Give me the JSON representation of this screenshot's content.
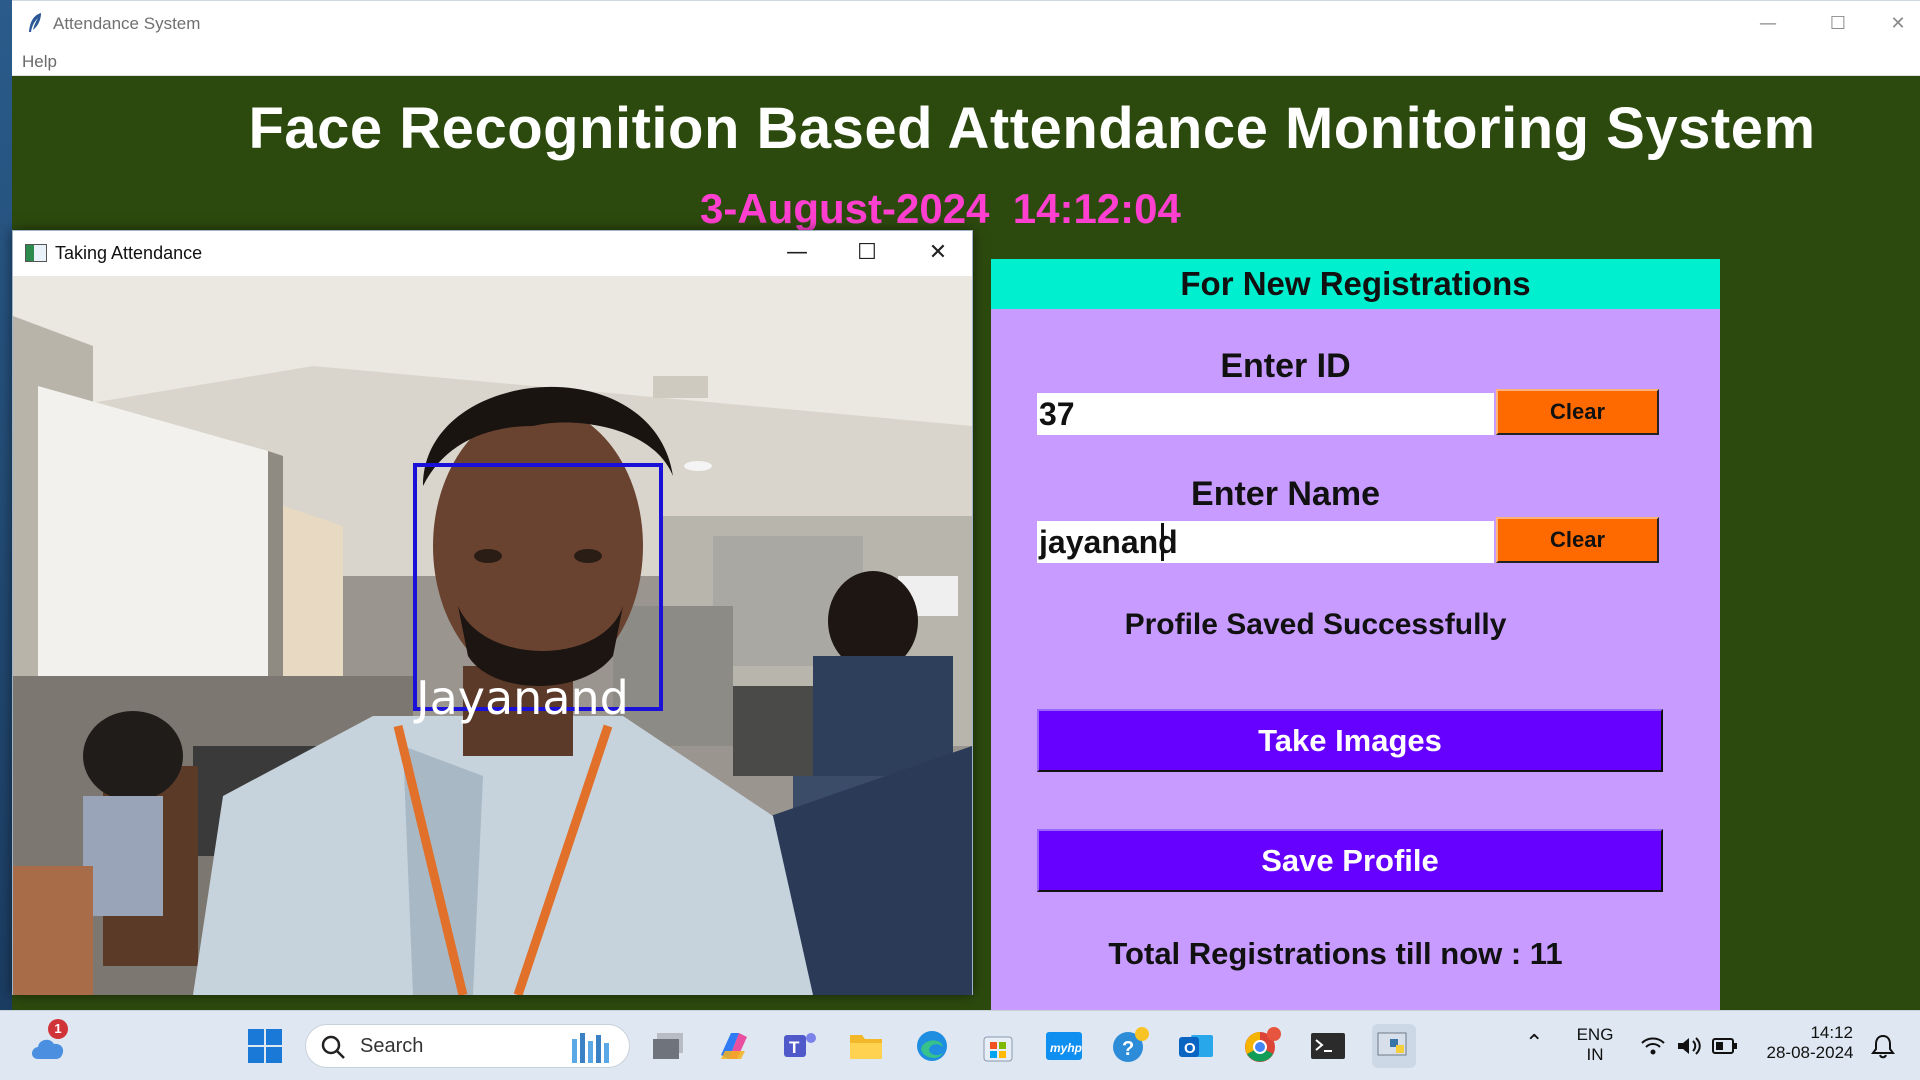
{
  "app": {
    "title": "Attendance System",
    "menu": [
      "Help"
    ],
    "heading": "Face Recognition Based Attendance Monitoring System",
    "datetime": "3-August-2024  14:12:04"
  },
  "registration": {
    "header": "For New Registrations",
    "id_label": "Enter ID",
    "id_value": "37",
    "name_label": "Enter Name",
    "name_value": "jayanand",
    "clear_label": "Clear",
    "status": "Profile Saved Successfully",
    "take_images_label": "Take Images",
    "save_profile_label": "Save Profile",
    "total_text": "Total Registrations till now  : 11"
  },
  "camera": {
    "title": "Taking Attendance",
    "face_label": "Jayanand"
  },
  "taskbar": {
    "search_placeholder": "Search",
    "weather_badge": "1",
    "language_line1": "ENG",
    "language_line2": "IN",
    "time": "14:12",
    "date": "28-08-2024"
  },
  "colors": {
    "app_background": "#2d4a0e",
    "panel_background": "#c79bff",
    "panel_header": "#00efce",
    "clear_button": "#ff6a00",
    "action_button": "#6600ff",
    "datetime_text": "#ff3fd0",
    "face_box": "#1a10d8"
  }
}
